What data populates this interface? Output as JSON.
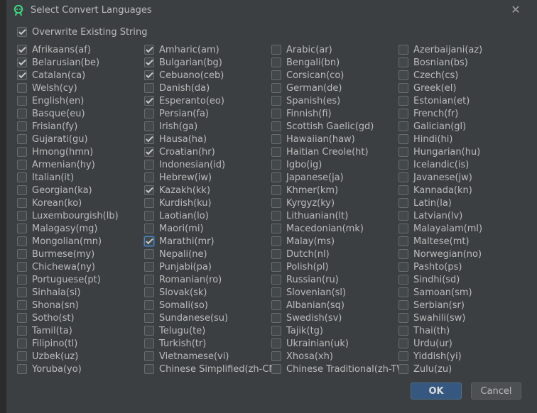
{
  "dialog": {
    "title": "Select Convert Languages",
    "close_label": "✕",
    "overwrite": {
      "label": "Overwrite Existing String",
      "checked": true
    },
    "ok_label": "OK",
    "cancel_label": "Cancel"
  },
  "columns": [
    [
      {
        "label": "Afrikaans(af)",
        "checked": true
      },
      {
        "label": "Belarusian(be)",
        "checked": true
      },
      {
        "label": "Catalan(ca)",
        "checked": true
      },
      {
        "label": "Welsh(cy)",
        "checked": false
      },
      {
        "label": "English(en)",
        "checked": false
      },
      {
        "label": "Basque(eu)",
        "checked": false
      },
      {
        "label": "Frisian(fy)",
        "checked": false
      },
      {
        "label": "Gujarati(gu)",
        "checked": false
      },
      {
        "label": "Hmong(hmn)",
        "checked": false
      },
      {
        "label": "Armenian(hy)",
        "checked": false
      },
      {
        "label": "Italian(it)",
        "checked": false
      },
      {
        "label": "Georgian(ka)",
        "checked": false
      },
      {
        "label": "Korean(ko)",
        "checked": false
      },
      {
        "label": "Luxembourgish(lb)",
        "checked": false
      },
      {
        "label": "Malagasy(mg)",
        "checked": false
      },
      {
        "label": "Mongolian(mn)",
        "checked": false
      },
      {
        "label": "Burmese(my)",
        "checked": false
      },
      {
        "label": "Chichewa(ny)",
        "checked": false
      },
      {
        "label": "Portuguese(pt)",
        "checked": false
      },
      {
        "label": "Sinhala(si)",
        "checked": false
      },
      {
        "label": "Shona(sn)",
        "checked": false
      },
      {
        "label": "Sotho(st)",
        "checked": false
      },
      {
        "label": "Tamil(ta)",
        "checked": false
      },
      {
        "label": "Filipino(tl)",
        "checked": false
      },
      {
        "label": "Uzbek(uz)",
        "checked": false
      },
      {
        "label": "Yoruba(yo)",
        "checked": false
      }
    ],
    [
      {
        "label": "Amharic(am)",
        "checked": true
      },
      {
        "label": "Bulgarian(bg)",
        "checked": true
      },
      {
        "label": "Cebuano(ceb)",
        "checked": true
      },
      {
        "label": "Danish(da)",
        "checked": false
      },
      {
        "label": "Esperanto(eo)",
        "checked": true
      },
      {
        "label": "Persian(fa)",
        "checked": false
      },
      {
        "label": "Irish(ga)",
        "checked": false
      },
      {
        "label": "Hausa(ha)",
        "checked": true
      },
      {
        "label": "Croatian(hr)",
        "checked": true
      },
      {
        "label": "Indonesian(id)",
        "checked": false
      },
      {
        "label": "Hebrew(iw)",
        "checked": false
      },
      {
        "label": "Kazakh(kk)",
        "checked": true
      },
      {
        "label": "Kurdish(ku)",
        "checked": false
      },
      {
        "label": "Laotian(lo)",
        "checked": false
      },
      {
        "label": "Maori(mi)",
        "checked": false
      },
      {
        "label": "Marathi(mr)",
        "checked": true,
        "focused": true
      },
      {
        "label": "Nepali(ne)",
        "checked": false
      },
      {
        "label": "Punjabi(pa)",
        "checked": false
      },
      {
        "label": "Romanian(ro)",
        "checked": false
      },
      {
        "label": "Slovak(sk)",
        "checked": false
      },
      {
        "label": "Somali(so)",
        "checked": false
      },
      {
        "label": "Sundanese(su)",
        "checked": false
      },
      {
        "label": "Telugu(te)",
        "checked": false
      },
      {
        "label": "Turkish(tr)",
        "checked": false
      },
      {
        "label": "Vietnamese(vi)",
        "checked": false
      },
      {
        "label": "Chinese Simplified(zh-CN)",
        "checked": false
      }
    ],
    [
      {
        "label": "Arabic(ar)",
        "checked": false
      },
      {
        "label": "Bengali(bn)",
        "checked": false
      },
      {
        "label": "Corsican(co)",
        "checked": false
      },
      {
        "label": "German(de)",
        "checked": false
      },
      {
        "label": "Spanish(es)",
        "checked": false
      },
      {
        "label": "Finnish(fi)",
        "checked": false
      },
      {
        "label": "Scottish Gaelic(gd)",
        "checked": false
      },
      {
        "label": "Hawaiian(haw)",
        "checked": false
      },
      {
        "label": "Haitian Creole(ht)",
        "checked": false
      },
      {
        "label": "Igbo(ig)",
        "checked": false
      },
      {
        "label": "Japanese(ja)",
        "checked": false
      },
      {
        "label": "Khmer(km)",
        "checked": false
      },
      {
        "label": "Kyrgyz(ky)",
        "checked": false
      },
      {
        "label": "Lithuanian(lt)",
        "checked": false
      },
      {
        "label": "Macedonian(mk)",
        "checked": false
      },
      {
        "label": "Malay(ms)",
        "checked": false
      },
      {
        "label": "Dutch(nl)",
        "checked": false
      },
      {
        "label": "Polish(pl)",
        "checked": false
      },
      {
        "label": "Russian(ru)",
        "checked": false
      },
      {
        "label": "Slovenian(sl)",
        "checked": false
      },
      {
        "label": "Albanian(sq)",
        "checked": false
      },
      {
        "label": "Swedish(sv)",
        "checked": false
      },
      {
        "label": "Tajik(tg)",
        "checked": false
      },
      {
        "label": "Ukrainian(uk)",
        "checked": false
      },
      {
        "label": "Xhosa(xh)",
        "checked": false
      },
      {
        "label": "Chinese Traditional(zh-TW)",
        "checked": false
      }
    ],
    [
      {
        "label": "Azerbaijani(az)",
        "checked": false
      },
      {
        "label": "Bosnian(bs)",
        "checked": false
      },
      {
        "label": "Czech(cs)",
        "checked": false
      },
      {
        "label": "Greek(el)",
        "checked": false
      },
      {
        "label": "Estonian(et)",
        "checked": false
      },
      {
        "label": "French(fr)",
        "checked": false
      },
      {
        "label": "Galician(gl)",
        "checked": false
      },
      {
        "label": "Hindi(hi)",
        "checked": false
      },
      {
        "label": "Hungarian(hu)",
        "checked": false
      },
      {
        "label": "Icelandic(is)",
        "checked": false
      },
      {
        "label": "Javanese(jw)",
        "checked": false
      },
      {
        "label": "Kannada(kn)",
        "checked": false
      },
      {
        "label": "Latin(la)",
        "checked": false
      },
      {
        "label": "Latvian(lv)",
        "checked": false
      },
      {
        "label": "Malayalam(ml)",
        "checked": false
      },
      {
        "label": "Maltese(mt)",
        "checked": false
      },
      {
        "label": "Norwegian(no)",
        "checked": false
      },
      {
        "label": "Pashto(ps)",
        "checked": false
      },
      {
        "label": "Sindhi(sd)",
        "checked": false
      },
      {
        "label": "Samoan(sm)",
        "checked": false
      },
      {
        "label": "Serbian(sr)",
        "checked": false
      },
      {
        "label": "Swahili(sw)",
        "checked": false
      },
      {
        "label": "Thai(th)",
        "checked": false
      },
      {
        "label": "Urdu(ur)",
        "checked": false
      },
      {
        "label": "Yiddish(yi)",
        "checked": false
      },
      {
        "label": "Zulu(zu)",
        "checked": false
      }
    ]
  ]
}
